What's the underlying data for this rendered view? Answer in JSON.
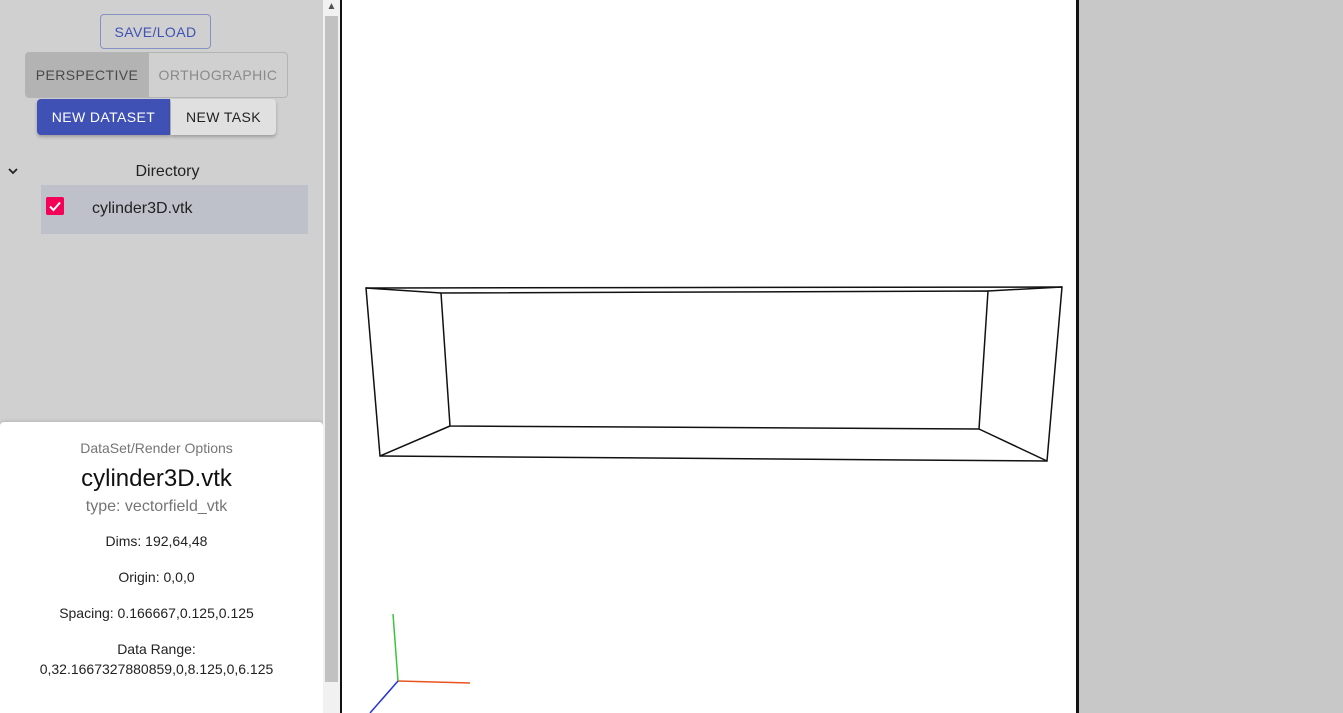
{
  "toolbar": {
    "save_load_label": "SAVE/LOAD",
    "camera_modes": [
      {
        "label": "PERSPECTIVE",
        "selected": true
      },
      {
        "label": "ORTHOGRAPHIC",
        "selected": false
      }
    ],
    "new_dataset_label": "NEW DATASET",
    "new_task_label": "NEW TASK"
  },
  "directory": {
    "title": "Directory",
    "items": [
      {
        "label": "cylinder3D.vtk",
        "checked": true
      }
    ]
  },
  "options": {
    "heading": "DataSet/Render Options",
    "name": "cylinder3D.vtk",
    "type": "type: vectorfield_vtk",
    "dims": "Dims: 192,64,48",
    "origin": "Origin: 0,0,0",
    "spacing": "Spacing: 0.166667,0.125,0.125",
    "data_range_label": "Data Range:",
    "data_range_value": "0,32.1667327880859,0,8.125,0,6.125"
  },
  "colors": {
    "primary": "#3f51b5",
    "checkbox": "#f50057",
    "axis_x": "#e8541e",
    "axis_y": "#3cc43c",
    "axis_z": "#2533d6"
  },
  "icons": {
    "directory_toggle": "chevron-down-icon",
    "scroll_up": "scroll-up-arrow-icon",
    "checkbox": "checkbox-checked-icon"
  }
}
